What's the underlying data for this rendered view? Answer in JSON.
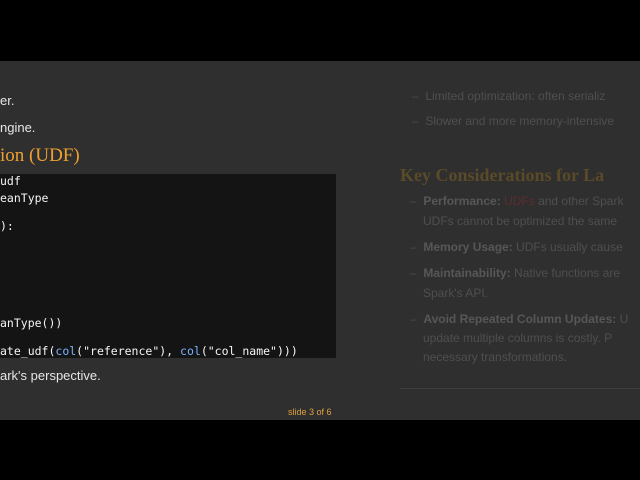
{
  "left": {
    "line1": "er.",
    "line2": "ngine.",
    "heading": "ion (UDF)",
    "code": {
      "l1": "udf",
      "l2": "eanType",
      "l3": "):",
      "l4_pre": "",
      "l4": "anType())",
      "l5_a": "ate_udf(",
      "l5_col1": "col",
      "l5_b": "(\"reference\"), ",
      "l5_col2": "col",
      "l5_c": "(\"col_name\")))"
    },
    "line_after": "ark's perspective.",
    "slide_indicator": "slide 3 of 6"
  },
  "right": {
    "item1": "Limited optimization: often serializ",
    "item2": "Slower and more memory-intensive",
    "heading": "Key Considerations for La",
    "perf_label": "Performance:",
    "perf_red": "UDFs",
    "perf_rest": " and other Spark",
    "perf_line2": "UDFs cannot be optimized the same",
    "mem_label": "Memory Usage:",
    "mem_rest": " UDFs usually cause",
    "maint_label": "Maintainability:",
    "maint_rest": " Native functions are",
    "maint_line2": "Spark's API.",
    "avoid_label": "Avoid Repeated Column Updates:",
    "avoid_rest": " U",
    "avoid_line2": "update multiple columns is costly. P",
    "avoid_line3": "necessary transformations."
  }
}
